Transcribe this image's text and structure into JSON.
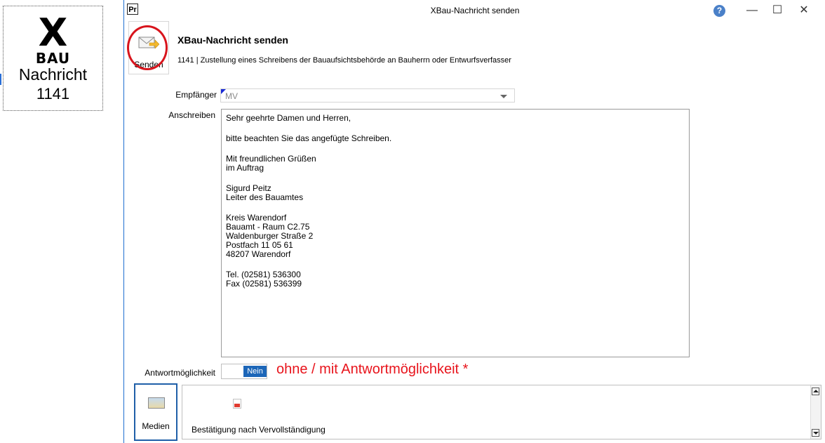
{
  "badge": {
    "x": "X",
    "bau": "BAU",
    "nachricht": "Nachricht",
    "number": "1141"
  },
  "window": {
    "app_icon": "Pr",
    "title": "XBau-Nachricht senden",
    "help": "?",
    "minimize": "—",
    "maximize": "☐",
    "close": "✕"
  },
  "send": {
    "label": "Senden"
  },
  "header": {
    "title": "XBau-Nachricht senden",
    "subtitle": "1141 | Zustellung eines Schreibens der Bauaufsichtsbehörde an Bauherrn oder Entwurfsverfasser"
  },
  "form": {
    "recipient_label": "Empfänger",
    "recipient_value": "MV",
    "letter_label": "Anschreiben",
    "letter_lines": [
      "Sehr geehrte Damen und Herren,",
      "",
      "bitte beachten Sie das angefügte Schreiben.",
      "",
      "Mit freundlichen Grüßen",
      "im Auftrag",
      "",
      "Sigurd Peitz",
      "Leiter des Bauamtes",
      "",
      "Kreis Warendorf",
      "Bauamt - Raum C2.75",
      "Waldenburger Straße 2",
      "Postfach 11 05 61",
      "48207 Warendorf",
      "",
      "Tel. (02581) 536300",
      "Fax (02581) 536399"
    ],
    "answer_label": "Antwortmöglichkeit",
    "answer_toggle": "Nein",
    "annotation": "ohne / mit Antwortmöglichkeit *"
  },
  "media": {
    "button_label": "Medien",
    "items": [
      {
        "label": "Bestätigung nach Vervollständigung",
        "icon": "pdf-icon"
      }
    ]
  }
}
